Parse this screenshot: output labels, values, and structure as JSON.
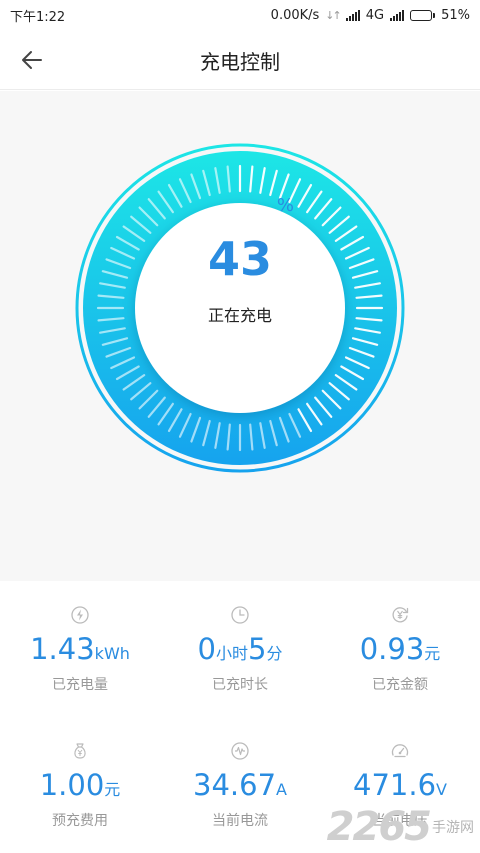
{
  "status_bar": {
    "time": "下午1:22",
    "net_speed": "0.00K/s",
    "network_type": "4G",
    "battery": "51%",
    "battery_level": 0.51
  },
  "header": {
    "title": "充电控制",
    "back_icon": "arrow-left-icon"
  },
  "gauge": {
    "percent_sign": "%",
    "value": "43",
    "status": "正在充电",
    "colors": {
      "start": "#1de6e6",
      "end": "#16a3ee",
      "text": "#2a8ce0"
    }
  },
  "stats": [
    {
      "icon": "lightning-icon",
      "value": "1.43",
      "unit": "kWh",
      "label": "已充电量"
    },
    {
      "icon": "clock-icon",
      "value": "0",
      "unit": "小时",
      "value2": "5",
      "unit2": "分",
      "label": "已充时长"
    },
    {
      "icon": "yen-refresh-icon",
      "value": "0.93",
      "unit": "元",
      "label": "已充金额"
    },
    {
      "icon": "money-bag-icon",
      "value": "1.00",
      "unit": "元",
      "label": "预充费用"
    },
    {
      "icon": "current-icon",
      "value": "34.67",
      "unit": "A",
      "label": "当前电流"
    },
    {
      "icon": "speedometer-icon",
      "value": "471.6",
      "unit": "V",
      "label": "当前电压"
    }
  ],
  "watermark": {
    "number": "2265",
    "text": "手游网"
  }
}
